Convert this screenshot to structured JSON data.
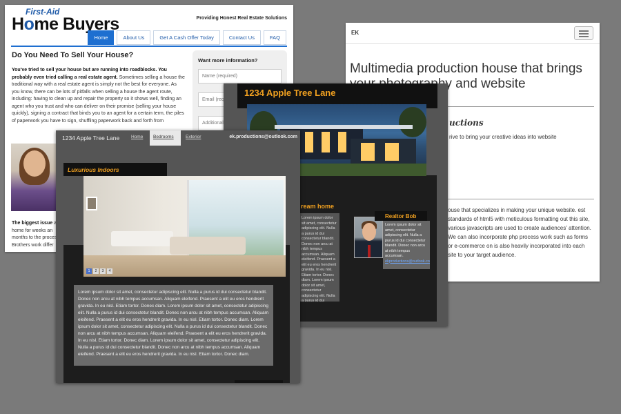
{
  "realestate": {
    "logo_top": "First-Aid",
    "logo_main_1": "H",
    "logo_main_o": "o",
    "logo_main_2": "me Buyers",
    "tagline": "Providing Honest Real Estate Solutions",
    "nav": [
      "Home",
      "About Us",
      "Get A Cash Offer Today",
      "Contact Us",
      "FAQ"
    ],
    "heading": "Do You Need To Sell Your House?",
    "intro_bold": "You've tried to sell your house but are running into roadblocks.  You probably even tried calling a real estate agent.",
    "intro_text": " Sometimes selling a house the traditional way with a real estate agent is simply not the best for everyone.  As you know, there can be lots of pitfalls when selling a house the agent route, including: having to clean up and repair the property so it shows well, finding an agent who you trust and who can deliver on their promise (selling your house quickly), signing a contract that binds you to an agent for a certain term, the piles of paperwork you have to sign, shuffling paperwork back and forth from",
    "bigissue_bold": "The biggest issue",
    "bigissue_text": " a home for weeks an months to the proces Brothers work differ",
    "form_title": "Want more information?",
    "form_fields": [
      "Name (required)",
      "Email (req",
      "Additional"
    ]
  },
  "multimedia": {
    "brand": "EK",
    "headline": "Multimedia production house that brings your photography and website",
    "sub": "uctions",
    "subtext": "rive to bring your creative ideas into website",
    "para": "ouse that specializes in making your unique website. est standards of html5 with meticulous formatting out this site, various javascripts are used to create audiences' attention. We can also incorporate php process work such as forms or e-commerce on is also heavily incorporated into each site to your target audience."
  },
  "exterior": {
    "title": "1234 Apple Tree Lane",
    "dream": "ream home",
    "col_text": "Lorem ipsum dolor sit amet, consectetur adipiscing elit. Nulla a purus id dui consectetur blandit. Donec non arcu at nibh tempus accumsan. Aliquam eleifend. Praesent a elit eu eros hendrerit gravida. In eu nisl. Etiam tortor. Donec diam. Lorem ipsum dolor sit amet, consectetur adipiscing elit. Nulla a purus id dui consectetur blandit. Donec non arcu at nibh tempus accumsan. Aliquam eleifend. Praesent a elit eu eros.",
    "realtor_name": "Realtor Bob",
    "realtor_text": "Lorem ipsum dolor sit amet, consectetur adipiscing elit. Nulla a purus id dui consectetur blandit. Donec non arcu at nibh tempus accumsan.",
    "realtor_email": "ekproductions@outlook.com"
  },
  "bedrooms": {
    "site_title": "1234 Apple Tree Lane",
    "nav": [
      "Home",
      "Bedrooms",
      "Exterior"
    ],
    "email": "ek.productions@outlook.com",
    "section": "Luxurious Indoors",
    "dots": [
      "1",
      "2",
      "3",
      "4"
    ],
    "lorem": "Lorem ipsum dolor sit amet, consectetur adipiscing elit. Nulla a purus id dui consectetur blandit. Donec non arcu at nibh tempus accumsan. Aliquam eleifend. Praesent a elit eu eros hendrerit gravida. In eu nisl. Etiam tortor. Donec diam. Lorem ipsum dolor sit amet, consectetur adipiscing elit. Nulla a purus id dui consectetur blandit. Donec non arcu at nibh tempus accumsan. Aliquam eleifend. Praesent a elit eu eros hendrerit gravida. In eu nisl. Etiam tortor. Donec diam. Lorem ipsum dolor sit amet, consectetur adipiscing elit. Nulla a purus id dui consectetur blandit. Donec non arcu at nibh tempus accumsan. Aliquam eleifend. Praesent a elit eu eros hendrerit gravida. In eu nisl. Etiam tortor. Donec diam. Lorem ipsum dolor sit amet, consectetur adipiscing elit. Nulla a purus id dui consectetur blandit. Donec non arcu at nibh tempus accumsan. Aliquam eleifend. Praesent a elit eu eros hendrerit gravida. In eu nisl. Etiam tortor. Donec diam."
  },
  "colors": {
    "background": "#7a7a7a",
    "accent_blue": "#1e6fd0",
    "accent_orange": "#f0a020"
  }
}
